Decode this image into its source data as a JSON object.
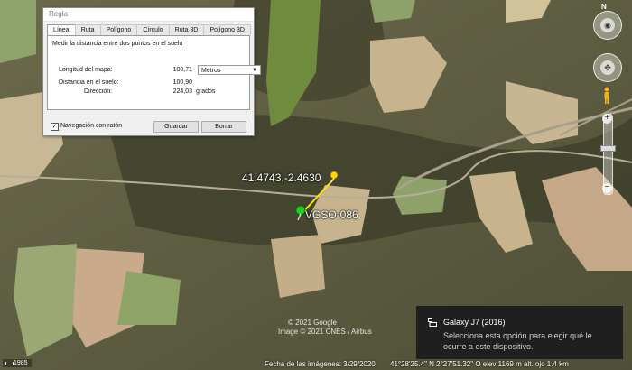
{
  "ruler": {
    "title": "Regla",
    "tabs": [
      "Línea",
      "Ruta",
      "Polígono",
      "Círculo",
      "Ruta 3D",
      "Polígono 3D"
    ],
    "description": "Medir la distancia entre dos puntos en el suelo",
    "map_length_label": "Longitud del mapa:",
    "map_length_value": "100,71",
    "unit_value": "Metros",
    "ground_length_label": "Distancia en el suelo:",
    "ground_length_value": "100,90",
    "direction_label": "Dirección:",
    "direction_value": "224,03",
    "direction_unit": "grados",
    "mouse_nav_label": "Navegación con ratón",
    "mouse_nav_checked": true,
    "save_label": "Guardar",
    "clear_label": "Borrar"
  },
  "map": {
    "coord_label": "41.4743,-2.4630",
    "point_label": "VGSO-086",
    "copyright_1": "© 2021 Google",
    "copyright_2": "Image © 2021 CNES / Airbus",
    "compass_letter": "N"
  },
  "status": {
    "year": "1985",
    "imagery_date": "Fecha de las imágenes: 3/29/2020",
    "coords": "41°28'25.4\" N   2°27'51.32\" O   elev   1169 m   alt. ojo   1.4 km"
  },
  "notification": {
    "title": "Galaxy J7 (2016)",
    "body": "Selecciona esta opción para elegir qué le ocurre a este dispositivo."
  },
  "colors": {
    "measure_line": "#ffe600",
    "pin_green": "#22cc22",
    "pin_yellow": "#ffd700"
  }
}
